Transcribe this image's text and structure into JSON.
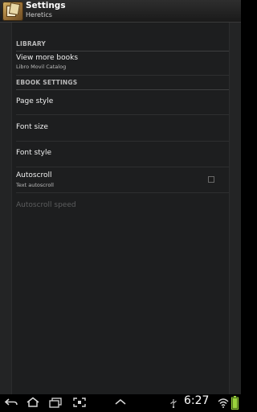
{
  "titlebar": {
    "title": "Settings",
    "subtitle": "Heretics"
  },
  "sections": {
    "library": {
      "header": "LIBRARY",
      "view_more": {
        "label": "View more books",
        "summary": "Libro Movil Catalog"
      }
    },
    "ebook": {
      "header": "EBOOK SETTINGS",
      "page_style": "Page style",
      "font_size": "Font size",
      "font_style": "Font style",
      "autoscroll": {
        "label": "Autoscroll",
        "summary": "Text autoscroll",
        "checked": false
      },
      "autoscroll_speed": {
        "label": "Autoscroll speed",
        "enabled": false
      }
    }
  },
  "statusbar": {
    "time": "6:27",
    "battery_level": 1.0
  },
  "colors": {
    "background": "#1d1e1f",
    "accent": "#33b5e5",
    "battery": "#9ad33c"
  }
}
